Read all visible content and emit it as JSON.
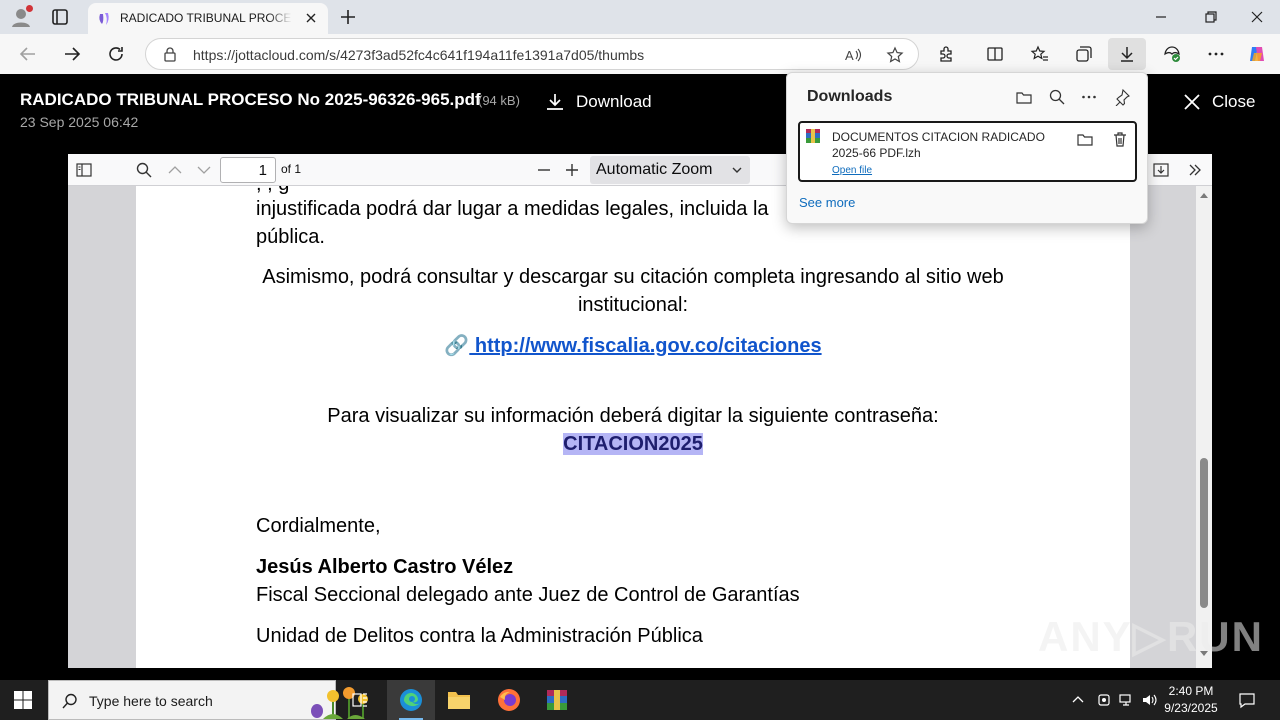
{
  "browser": {
    "tab_title": "RADICADO TRIBUNAL PROCESO No 2025-96326-965.pdf",
    "url": "https://jottacloud.com/s/4273f3ad52fc4c641f194a11fe1391a7d05/thumbs"
  },
  "viewer": {
    "file_name": "RADICADO TRIBUNAL PROCESO No 2025-96326-965.pdf",
    "file_size": "(94 kB)",
    "date": "23 Sep 2025 06:42",
    "download_label": "Download",
    "close_label": "Close"
  },
  "pdf_toolbar": {
    "page_number": "1",
    "page_count": "of 1",
    "zoom": "Automatic Zoom"
  },
  "pdf_content": {
    "line1": "injustificada podrá dar lugar a medidas legales, incluida la",
    "line2": "pública.",
    "para2_line1": "Asimismo, podrá consultar y descargar su citación completa ingresando al sitio web",
    "para2_line2": "institucional:",
    "link_text": " http://www.fiscalia.gov.co/citaciones",
    "password_prompt": "Para visualizar su información deberá digitar la siguiente contraseña:",
    "password": "CITACION2025",
    "closing": "Cordialmente,",
    "signer_name": "Jesús Alberto Castro Vélez",
    "signer_title": "Fiscal Seccional delegado ante Juez de Control de Garantías",
    "signer_unit": "Unidad de Delitos contra la Administración Pública"
  },
  "downloads": {
    "title": "Downloads",
    "item_name": "DOCUMENTOS CITACION RADICADO 2025-66 PDF.lzh",
    "open_file": "Open file",
    "see_more": "See more"
  },
  "watermark": "ANY▷RUN",
  "taskbar": {
    "search_placeholder": "Type here to search",
    "time": "2:40 PM",
    "date": "9/23/2025"
  },
  "colors": {
    "link": "#1155cc",
    "highlight": "#b5b5f5",
    "accent": "#0f6cbd"
  }
}
